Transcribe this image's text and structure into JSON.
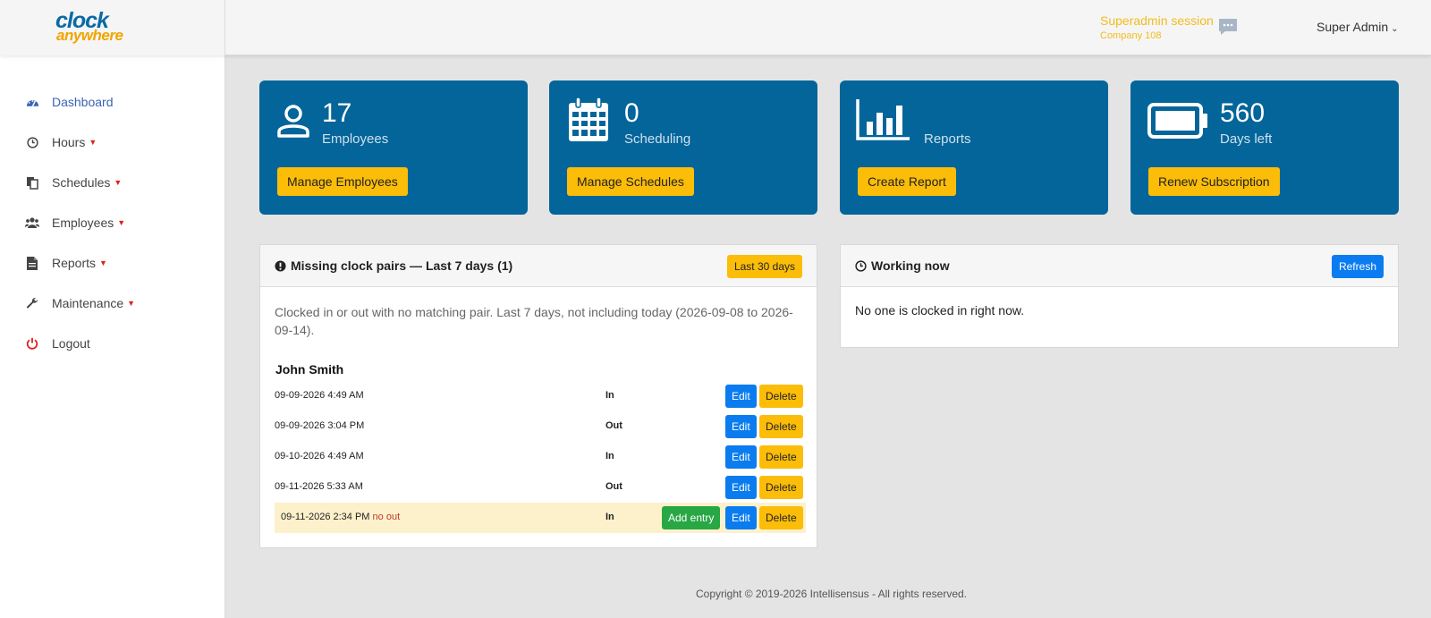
{
  "header": {
    "logo_line1": "clock",
    "logo_line2": "anywhere",
    "session_title": "Superadmin session",
    "session_company": "Company 108",
    "user_name": "Super Admin",
    "accent_color": "#f3bc1d"
  },
  "sidebar": {
    "items": [
      {
        "label": "Dashboard",
        "icon": "dashboard-icon"
      },
      {
        "label": "Hours",
        "icon": "clock-icon"
      },
      {
        "label": "Schedules",
        "icon": "copy-icon"
      },
      {
        "label": "Employees",
        "icon": "users-icon"
      },
      {
        "label": "Reports",
        "icon": "file-icon"
      },
      {
        "label": "Maintenance",
        "icon": "wrench-icon"
      },
      {
        "label": "Logout",
        "icon": "power-icon"
      }
    ]
  },
  "cards": [
    {
      "value": "17",
      "label": "Employees",
      "button": "Manage Employees",
      "icon": "user-icon"
    },
    {
      "value": "0",
      "label": "Scheduling",
      "button": "Manage Schedules",
      "icon": "calendar-icon"
    },
    {
      "value": "",
      "label": "Reports",
      "button": "Create Report",
      "icon": "bar-chart-icon"
    },
    {
      "value": "560",
      "label": "Days left",
      "button": "Renew Subscription",
      "icon": "battery-icon"
    }
  ],
  "missing": {
    "title": "Missing clock pairs — Last 7 days (1)",
    "range_button": "Last 30 days",
    "description": "Clocked in or out with no matching pair. Last 7 days, not including today (2026-09-08 to 2026-09-14).",
    "employee": "John Smith",
    "rows": [
      {
        "date": "09-09-2026 4:49 AM",
        "note": "",
        "direction": "In"
      },
      {
        "date": "09-09-2026 3:04 PM",
        "note": "",
        "direction": "Out"
      },
      {
        "date": "09-10-2026 4:49 AM",
        "note": "",
        "direction": "In"
      },
      {
        "date": "09-11-2026 5:33 AM",
        "note": "",
        "direction": "Out"
      },
      {
        "date": "09-11-2026 2:34 PM",
        "note": "no out",
        "direction": "In"
      }
    ],
    "edit_label": "Edit",
    "delete_label": "Delete",
    "add_entry_label": "Add entry"
  },
  "working": {
    "title": "Working now",
    "refresh_label": "Refresh",
    "empty_text": "No one is clocked in right now."
  },
  "footer": {
    "text": "Copyright © 2019-2026 Intellisensus - All rights reserved."
  }
}
